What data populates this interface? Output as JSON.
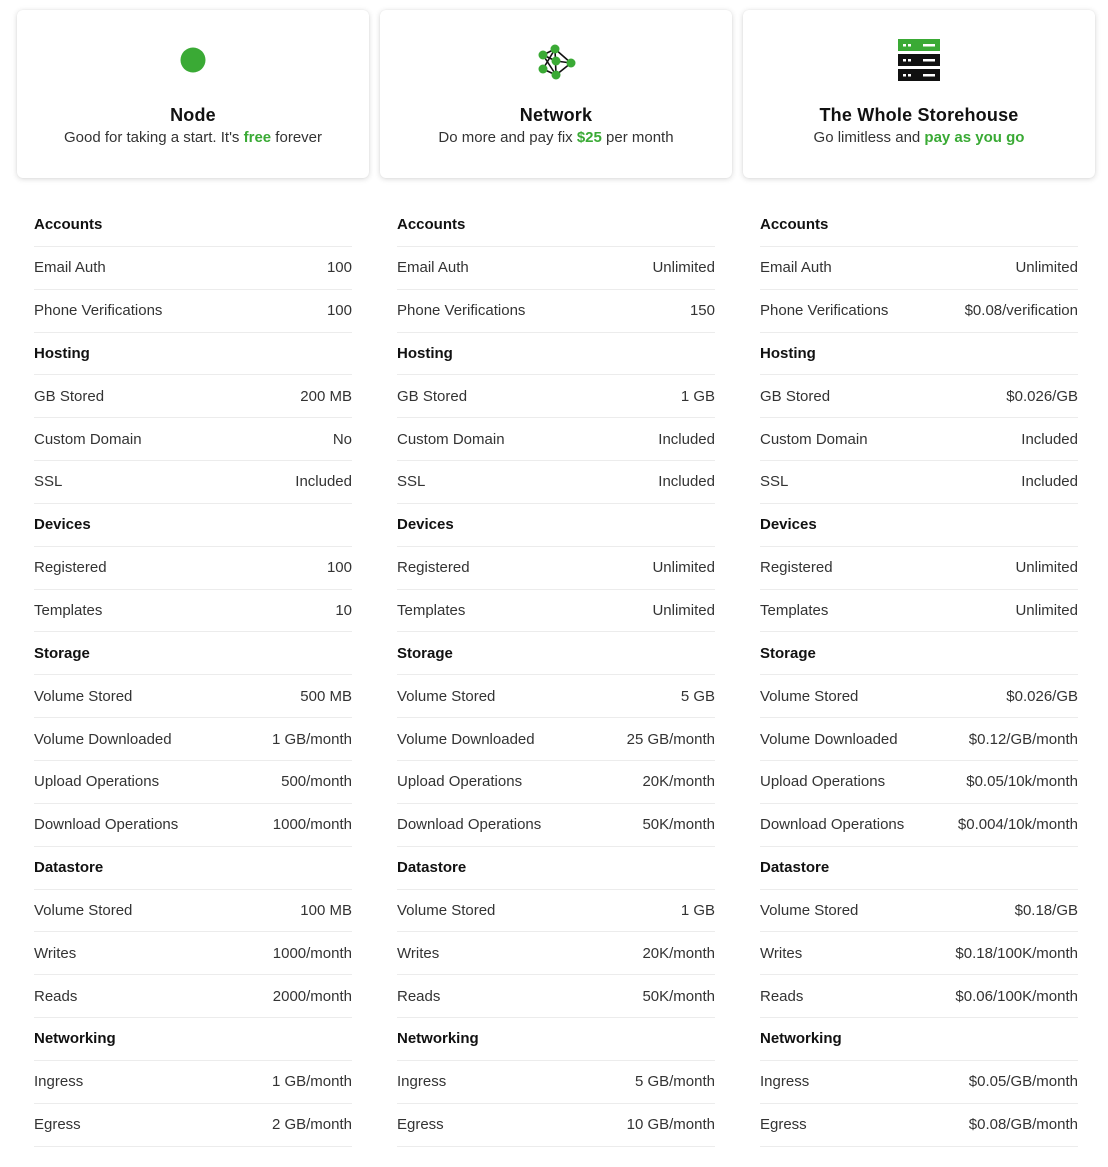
{
  "accent_color": "#3aaa35",
  "plans": [
    {
      "icon": "dot-icon",
      "title": "Node",
      "subtitle_pre": "Good for taking a start. It's ",
      "subtitle_highlight": "free",
      "subtitle_post": " forever",
      "sections": [
        {
          "name": "Accounts",
          "rows": [
            {
              "label": "Email Auth",
              "value": "100"
            },
            {
              "label": "Phone Verifications",
              "value": "100"
            }
          ]
        },
        {
          "name": "Hosting",
          "rows": [
            {
              "label": "GB Stored",
              "value": "200 MB"
            },
            {
              "label": "Custom Domain",
              "value": "No"
            },
            {
              "label": "SSL",
              "value": "Included"
            }
          ]
        },
        {
          "name": "Devices",
          "rows": [
            {
              "label": "Registered",
              "value": "100"
            },
            {
              "label": "Templates",
              "value": "10"
            }
          ]
        },
        {
          "name": "Storage",
          "rows": [
            {
              "label": "Volume Stored",
              "value": "500 MB"
            },
            {
              "label": "Volume Downloaded",
              "value": "1 GB/month"
            },
            {
              "label": "Upload Operations",
              "value": "500/month"
            },
            {
              "label": "Download Operations",
              "value": "1000/month"
            }
          ]
        },
        {
          "name": "Datastore",
          "rows": [
            {
              "label": "Volume Stored",
              "value": "100 MB"
            },
            {
              "label": "Writes",
              "value": "1000/month"
            },
            {
              "label": "Reads",
              "value": "2000/month"
            }
          ]
        },
        {
          "name": "Networking",
          "rows": [
            {
              "label": "Ingress",
              "value": "1 GB/month"
            },
            {
              "label": "Egress",
              "value": "2 GB/month"
            }
          ]
        }
      ]
    },
    {
      "icon": "network-graph-icon",
      "title": "Network",
      "subtitle_pre": "Do more and pay fix ",
      "subtitle_highlight": "$25",
      "subtitle_post": " per month",
      "sections": [
        {
          "name": "Accounts",
          "rows": [
            {
              "label": "Email Auth",
              "value": "Unlimited"
            },
            {
              "label": "Phone Verifications",
              "value": "150"
            }
          ]
        },
        {
          "name": "Hosting",
          "rows": [
            {
              "label": "GB Stored",
              "value": "1 GB"
            },
            {
              "label": "Custom Domain",
              "value": "Included"
            },
            {
              "label": "SSL",
              "value": "Included"
            }
          ]
        },
        {
          "name": "Devices",
          "rows": [
            {
              "label": "Registered",
              "value": "Unlimited"
            },
            {
              "label": "Templates",
              "value": "Unlimited"
            }
          ]
        },
        {
          "name": "Storage",
          "rows": [
            {
              "label": "Volume Stored",
              "value": "5 GB"
            },
            {
              "label": "Volume Downloaded",
              "value": "25 GB/month"
            },
            {
              "label": "Upload Operations",
              "value": "20K/month"
            },
            {
              "label": "Download Operations",
              "value": "50K/month"
            }
          ]
        },
        {
          "name": "Datastore",
          "rows": [
            {
              "label": "Volume Stored",
              "value": "1 GB"
            },
            {
              "label": "Writes",
              "value": "20K/month"
            },
            {
              "label": "Reads",
              "value": "50K/month"
            }
          ]
        },
        {
          "name": "Networking",
          "rows": [
            {
              "label": "Ingress",
              "value": "5 GB/month"
            },
            {
              "label": "Egress",
              "value": "10 GB/month"
            }
          ]
        }
      ]
    },
    {
      "icon": "server-stack-icon",
      "title": "The Whole Storehouse",
      "subtitle_pre": "Go limitless and ",
      "subtitle_highlight": "pay as you go",
      "subtitle_post": "",
      "sections": [
        {
          "name": "Accounts",
          "rows": [
            {
              "label": "Email Auth",
              "value": "Unlimited"
            },
            {
              "label": "Phone Verifications",
              "value": "$0.08/verification"
            }
          ]
        },
        {
          "name": "Hosting",
          "rows": [
            {
              "label": "GB Stored",
              "value": "$0.026/GB"
            },
            {
              "label": "Custom Domain",
              "value": "Included"
            },
            {
              "label": "SSL",
              "value": "Included"
            }
          ]
        },
        {
          "name": "Devices",
          "rows": [
            {
              "label": "Registered",
              "value": "Unlimited"
            },
            {
              "label": "Templates",
              "value": "Unlimited"
            }
          ]
        },
        {
          "name": "Storage",
          "rows": [
            {
              "label": "Volume Stored",
              "value": "$0.026/GB"
            },
            {
              "label": "Volume Downloaded",
              "value": "$0.12/GB/month"
            },
            {
              "label": "Upload Operations",
              "value": "$0.05/10k/month"
            },
            {
              "label": "Download Operations",
              "value": "$0.004/10k/month"
            }
          ]
        },
        {
          "name": "Datastore",
          "rows": [
            {
              "label": "Volume Stored",
              "value": "$0.18/GB"
            },
            {
              "label": "Writes",
              "value": "$0.18/100K/month"
            },
            {
              "label": "Reads",
              "value": "$0.06/100K/month"
            }
          ]
        },
        {
          "name": "Networking",
          "rows": [
            {
              "label": "Ingress",
              "value": "$0.05/GB/month"
            },
            {
              "label": "Egress",
              "value": "$0.08/GB/month"
            }
          ]
        }
      ]
    }
  ]
}
